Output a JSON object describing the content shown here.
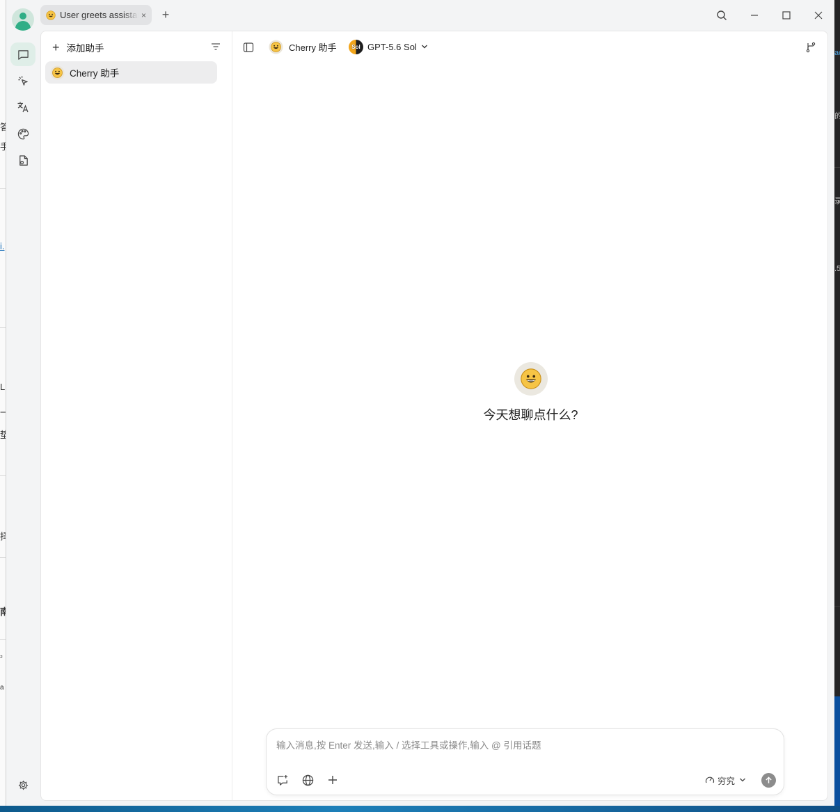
{
  "window": {
    "tab_title": "User greets assistant",
    "tab_close": "×",
    "new_tab": "+"
  },
  "sidebar": {
    "add_assistant_label": "添加助手",
    "assistants": [
      {
        "name": "Cherry 助手",
        "icon": "grinning-face-emoji"
      }
    ]
  },
  "chat_header": {
    "assistant_name": "Cherry 助手",
    "model_name": "GPT-5.6 Sol",
    "model_logo_text": "Sol"
  },
  "welcome": {
    "greeting": "今天想聊点什么?"
  },
  "composer": {
    "placeholder": "输入消息,按 Enter 发送,输入 / 选择工具或操作,输入 @ 引用话题",
    "value": "",
    "reasoning_label": "穷究"
  },
  "background_fragments": {
    "left": [
      "答",
      "手",
      "i.",
      "招",
      "L",
      "一",
      "垫",
      "择",
      "南",
      "₂",
      "a"
    ],
    "right": [
      "ac",
      "的",
      "录",
      ".5"
    ]
  },
  "colors": {
    "accent": "#2fae86",
    "nav_active_bg": "#dfeee8",
    "send_button": "#8c8c8c",
    "model_logo_orange": "#f2a51a"
  }
}
